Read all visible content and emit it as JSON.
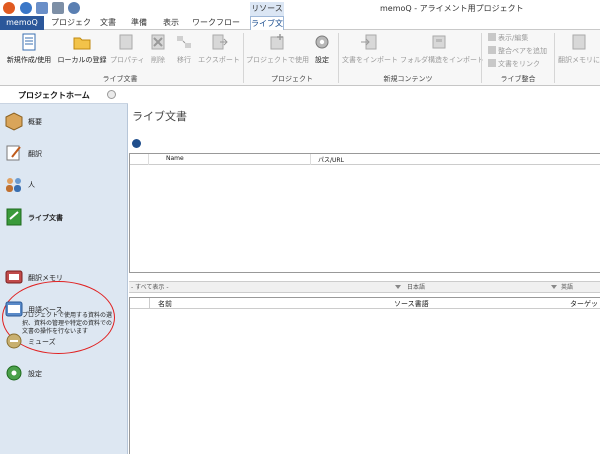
{
  "titlebar": {
    "context_label": "リソース",
    "window_title": "memoQ - アライメント用プロジェクト"
  },
  "tabs": [
    {
      "label": "memoQ"
    },
    {
      "label": "プロジェクト"
    },
    {
      "label": "文書"
    },
    {
      "label": "準備"
    },
    {
      "label": "表示"
    },
    {
      "label": "ワークフロー"
    },
    {
      "label": "ライブ文書"
    }
  ],
  "ribbon": {
    "buttons": {
      "new": "新規作成/使用",
      "register_local": "ローカルの登録",
      "properties": "プロパティ",
      "delete": "削除",
      "move": "移行",
      "export": "エクスポート",
      "use_in_project": "プロジェクトで使用",
      "settings": "設定",
      "import_doc": "文書をインポート",
      "import_folder": "フォルダ構造をインポート",
      "translation_memory": "翻訳メモリに"
    },
    "small_buttons": {
      "view_edit": "表示/編集",
      "add_alignment_pair": "整合ペアを追加",
      "link_document": "文書をリンク"
    },
    "groups": {
      "live_docs": "ライブ文書",
      "project": "プロジェクト",
      "new_content": "新規コンテンツ",
      "alignment": "ライブ整合"
    }
  },
  "sidebar": {
    "title": "プロジェクトホーム",
    "items": [
      {
        "label": "概要"
      },
      {
        "label": "翻訳"
      },
      {
        "label": "人"
      },
      {
        "label": "ライブ文書"
      },
      {
        "label": "翻訳メモリ"
      },
      {
        "label": "用語ベース"
      },
      {
        "label": "ミューズ"
      },
      {
        "label": "設定"
      }
    ],
    "selected_description": "プロジェクトで使用する資料の選択、資料の管理や特定の資料での文書の操作を行ないます"
  },
  "main": {
    "title": "ライブ文書",
    "grid1_columns": {
      "name": "Name",
      "path": "パス/URL"
    },
    "filter": {
      "show_all": "- すべて表示 -",
      "source_lang": "日本語",
      "target_lang": "英語"
    },
    "grid2_columns": {
      "name": "名前",
      "source_file": "ソース書語",
      "target": "ターゲット"
    }
  }
}
